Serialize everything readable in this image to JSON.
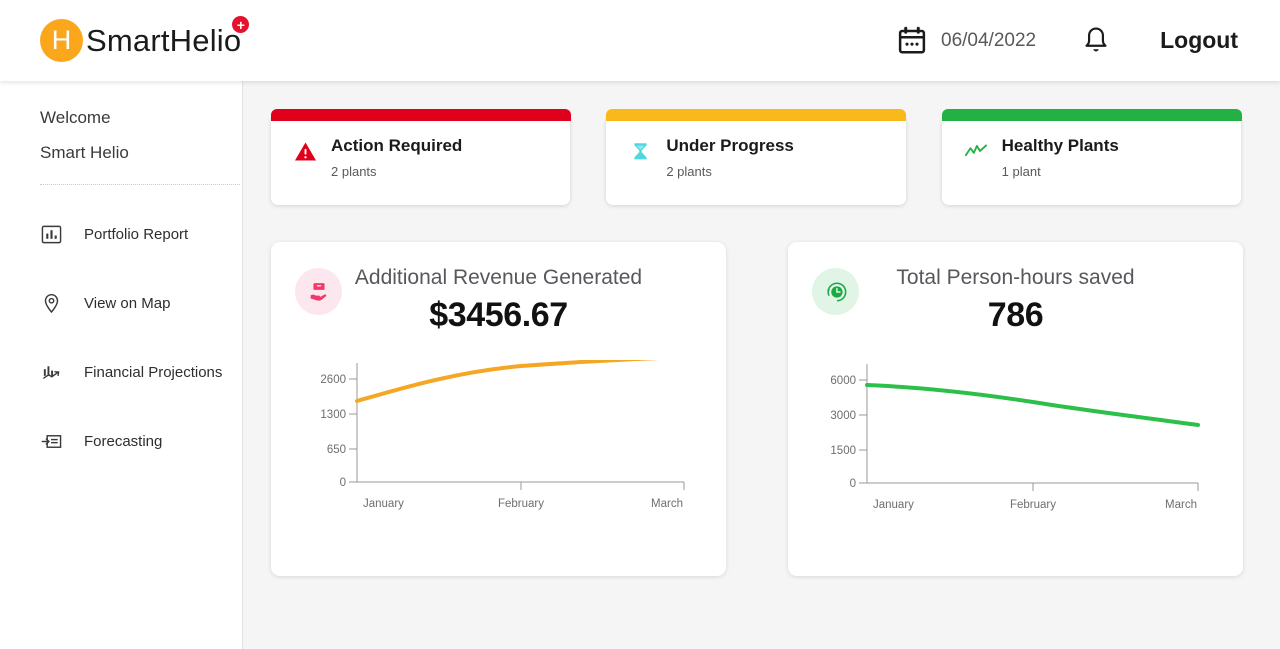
{
  "header": {
    "brand_initial": "H",
    "brand_name": "SmartHelio",
    "brand_badge_icon": "swiss-cross-icon",
    "date": "06/04/2022",
    "calendar_icon": "calendar-icon",
    "bell_icon": "bell-icon",
    "logout_label": "Logout"
  },
  "sidebar": {
    "welcome_label": "Welcome",
    "account_name": "Smart Helio",
    "items": [
      {
        "label": "Portfolio Report",
        "icon": "bar-chart-icon"
      },
      {
        "label": "View on Map",
        "icon": "map-pin-icon"
      },
      {
        "label": "Financial Projections",
        "icon": "financial-chart-icon"
      },
      {
        "label": "Forecasting",
        "icon": "forecast-card-icon"
      }
    ]
  },
  "status_cards": [
    {
      "title": "Action Required",
      "count": "2 plants",
      "color": "#E0001B",
      "icon": "warning-triangle-icon",
      "icon_color": "#E0001B"
    },
    {
      "title": "Under Progress",
      "count": "2 plants",
      "color": "#F9B91B",
      "icon": "hourglass-icon",
      "icon_color": "#4FD8E0"
    },
    {
      "title": "Healthy Plants",
      "count": "1 plant",
      "color": "#23B145",
      "icon": "trend-line-icon",
      "icon_color": "#23B145"
    }
  ],
  "metric_cards": [
    {
      "title": "Additional Revenue Generated",
      "value": "$3456.67",
      "icon": "hand-holding-box-icon",
      "icon_color": "#F2396B",
      "icon_bg": "#FDE7EE",
      "line_color": "#F5A623"
    },
    {
      "title": "Total Person-hours saved",
      "value": "786",
      "icon": "clock-history-icon",
      "icon_color": "#1BA943",
      "icon_bg": "#E1F5E6",
      "line_color": "#2CC04A"
    }
  ],
  "chart_data": [
    {
      "type": "line",
      "title": "Additional Revenue Generated",
      "xlabel": "",
      "ylabel": "",
      "categories": [
        "January",
        "February",
        "March"
      ],
      "x": [
        "January",
        "February",
        "March"
      ],
      "ytick_labels": [
        "0",
        "650",
        "1300",
        "2600"
      ],
      "ytick_values": [
        0,
        650,
        1300,
        2600
      ],
      "ylim": [
        0,
        3400
      ],
      "grid": false,
      "legend": false,
      "series": [
        {
          "name": "Additional Revenue Generated",
          "color": "#F5A623",
          "values": [
            1550,
            2990,
            3120
          ],
          "points": [
            {
              "x": "January",
              "y": 1550
            },
            {
              "x": "mid-Jan-Feb",
              "y": 2450
            },
            {
              "x": "February",
              "y": 2990
            },
            {
              "x": "March",
              "y": 3120
            }
          ]
        }
      ]
    },
    {
      "type": "line",
      "title": "Total Person-hours saved",
      "xlabel": "",
      "ylabel": "",
      "categories": [
        "January",
        "February",
        "March"
      ],
      "x": [
        "January",
        "February",
        "March"
      ],
      "ytick_labels": [
        "0",
        "1500",
        "3000",
        "6000"
      ],
      "ytick_values": [
        0,
        1500,
        3000,
        6000
      ],
      "ylim": [
        0,
        7000
      ],
      "grid": false,
      "legend": false,
      "series": [
        {
          "name": "Total Person-hours saved",
          "color": "#2CC04A",
          "values": [
            5400,
            4200,
            2850
          ],
          "points": [
            {
              "x": "January",
              "y": 5400
            },
            {
              "x": "mid-Jan-Feb",
              "y": 5150
            },
            {
              "x": "February",
              "y": 4200
            },
            {
              "x": "March",
              "y": 2850
            }
          ]
        }
      ]
    }
  ]
}
